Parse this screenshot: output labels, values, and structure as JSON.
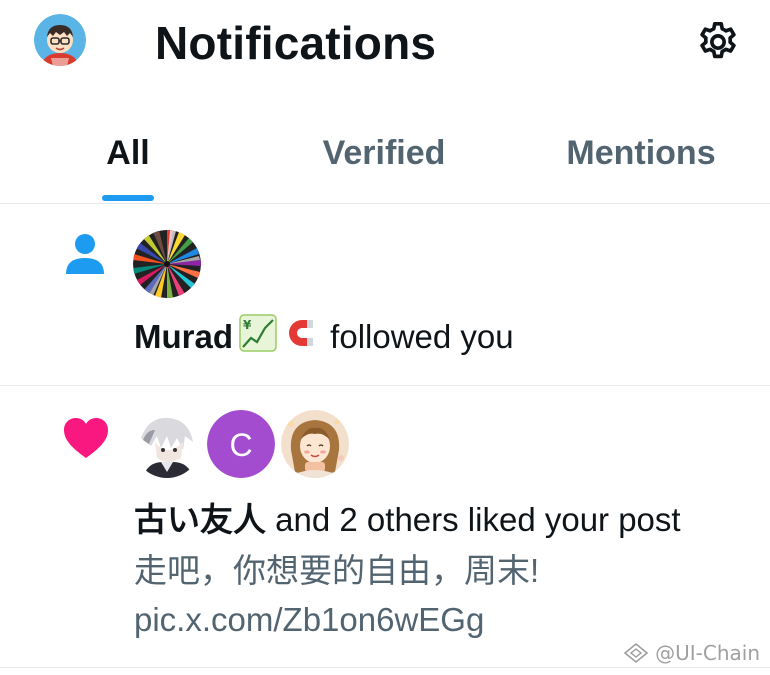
{
  "header": {
    "title": "Notifications",
    "avatar_icon": "user-avatar",
    "settings_icon": "gear-icon"
  },
  "tabs": [
    {
      "label": "All",
      "active": true
    },
    {
      "label": "Verified",
      "active": false
    },
    {
      "label": "Mentions",
      "active": false
    }
  ],
  "notifications": [
    {
      "type_icon": "person-icon",
      "actor": "Murad",
      "emojis": [
        "chart-increasing-with-yen",
        "magnet"
      ],
      "action": " followed you"
    },
    {
      "type_icon": "heart-icon",
      "avatars": [
        {
          "kind": "image",
          "desc": "anime-character"
        },
        {
          "kind": "letter",
          "letter": "C",
          "color": "#a34ccf"
        },
        {
          "kind": "image",
          "desc": "anime-girl"
        }
      ],
      "actor": "古い友人",
      "action": " and 2 others liked your post",
      "post_text": "走吧，你想要的自由，周末!",
      "post_link": "pic.x.com/Zb1on6wEGg"
    }
  ],
  "watermark": "@UI-Chain",
  "colors": {
    "accent": "#1d9bf0",
    "like": "#f91880",
    "muted_text": "#536471",
    "text": "#0f1419",
    "divider": "#e6e9ec"
  }
}
